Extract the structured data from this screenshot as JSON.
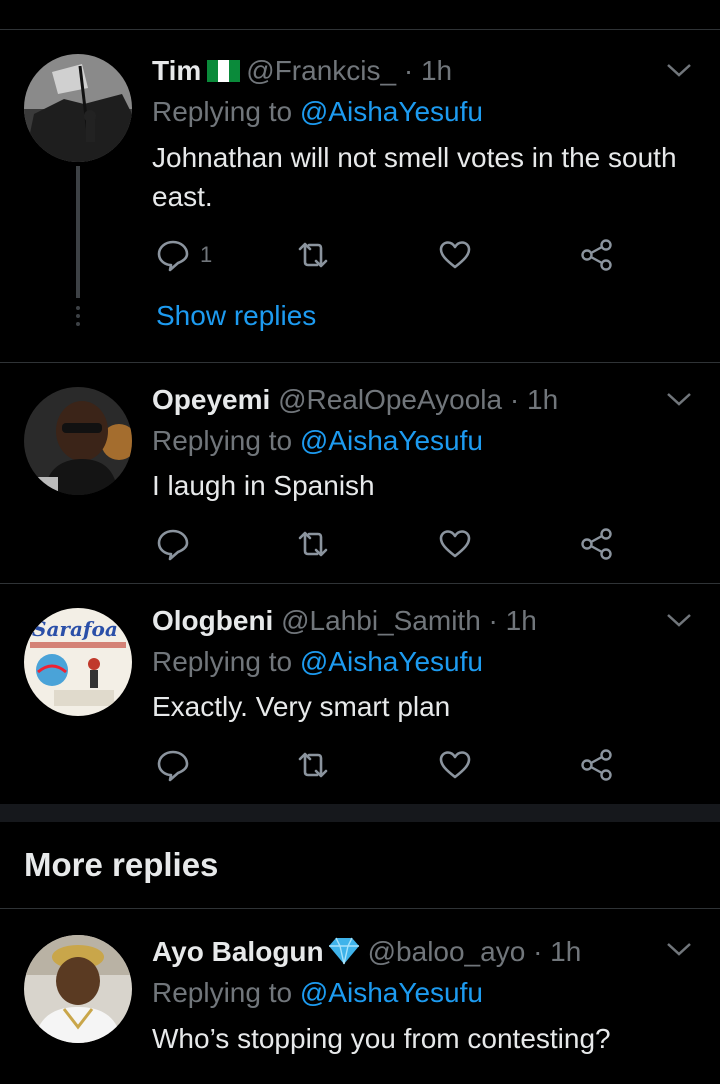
{
  "colors": {
    "accent": "#1d9bf0",
    "muted": "#71767b",
    "text": "#e7e9ea",
    "background": "#000000"
  },
  "tweets": [
    {
      "name": "Tim",
      "badge": "nigeria-flag-icon",
      "handle": "@Frankcis_",
      "sep": "·",
      "time": "1h",
      "replying_prefix": "Replying to",
      "replying_to": "@AishaYesufu",
      "text": "Johnathan will not smell votes in the south east.",
      "reply_count": "1",
      "show_replies": "Show replies"
    },
    {
      "name": "Opeyemi",
      "handle": "@RealOpeAyoola",
      "sep": "·",
      "time": "1h",
      "replying_prefix": "Replying to",
      "replying_to": "@AishaYesufu",
      "text": "I laugh in Spanish"
    },
    {
      "name": "Ologbeni",
      "handle": "@Lahbi_Samith",
      "sep": "·",
      "time": "1h",
      "replying_prefix": "Replying to",
      "replying_to": "@AishaYesufu",
      "text": "Exactly. Very smart plan"
    },
    {
      "name": "Ayo Balogun",
      "badge": "diamond-icon",
      "handle": "@baloo_ayo",
      "sep": "·",
      "time": "1h",
      "replying_prefix": "Replying to",
      "replying_to": "@AishaYesufu",
      "text": "Who’s stopping you from contesting?"
    }
  ],
  "section": {
    "more_replies": "More replies"
  }
}
